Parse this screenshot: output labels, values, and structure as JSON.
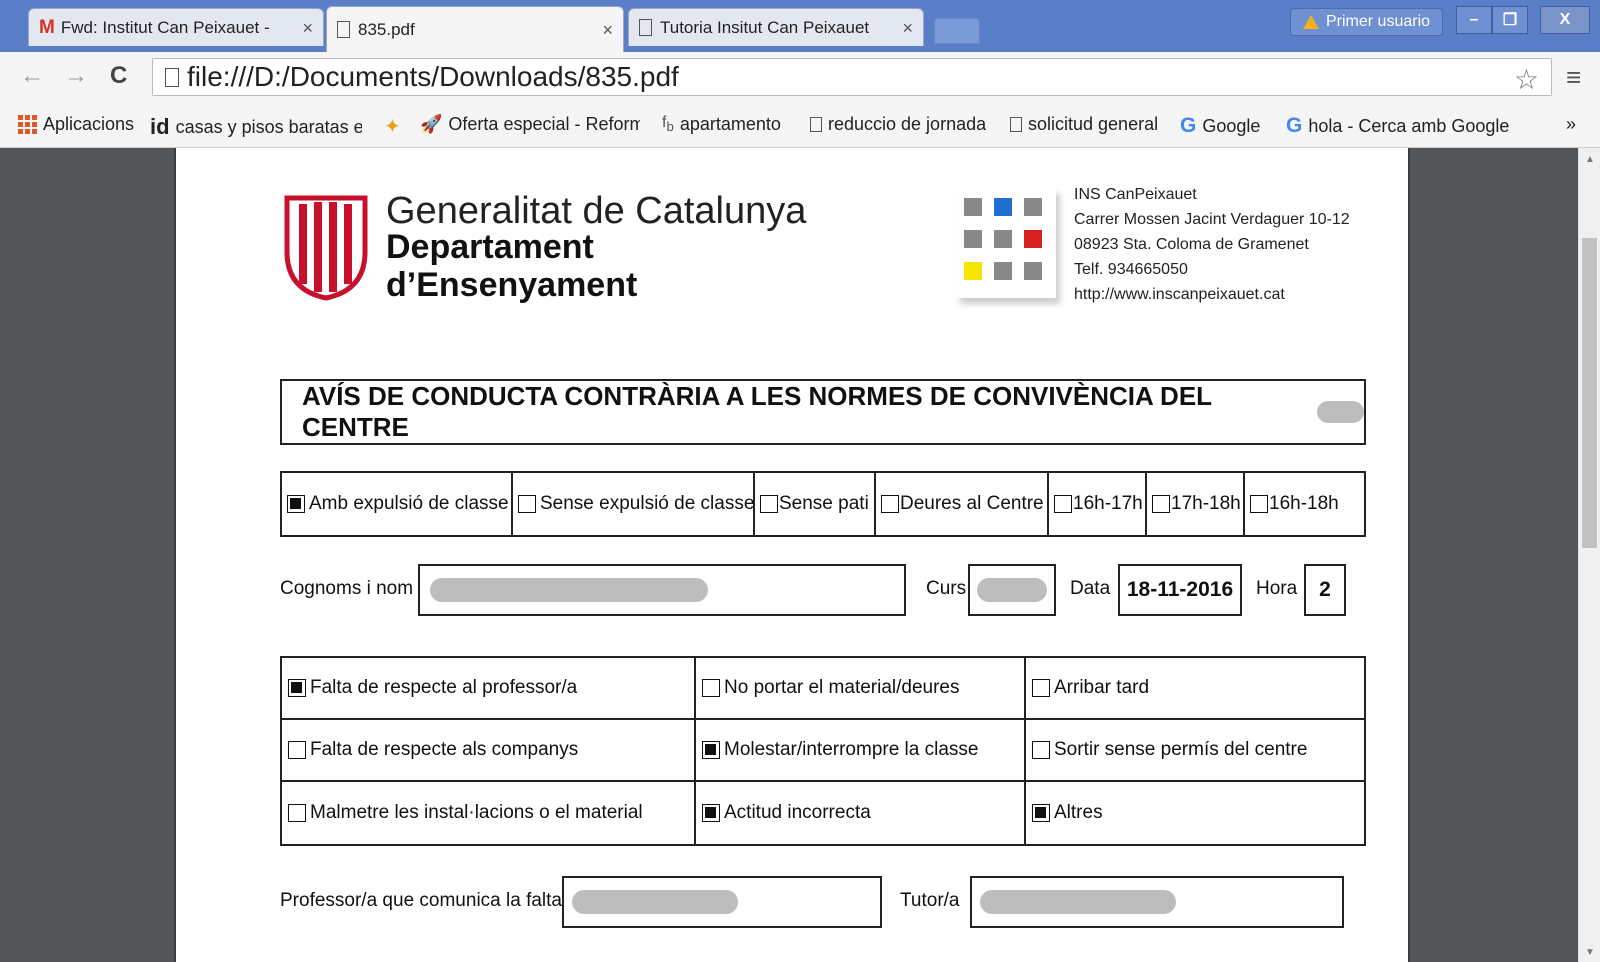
{
  "browser": {
    "tabs": [
      {
        "icon": "gmail-icon",
        "label": "Fwd: Institut Can Peixauet -"
      },
      {
        "icon": "page-icon",
        "label": "835.pdf"
      },
      {
        "icon": "page-icon",
        "label": "Tutoria Insitut Can Peixauet"
      }
    ],
    "tab_close": "×",
    "user_label": "Primer usuario",
    "window_buttons": {
      "minimize": "–",
      "restore": "❐",
      "close": "X"
    },
    "url": "file:///D:/Documents/Downloads/835.pdf",
    "nav": {
      "back": "←",
      "forward": "→",
      "reload": "C"
    },
    "star": "☆",
    "menu": "≡",
    "bookmarks": [
      {
        "icon": "apps-icon",
        "label": "Aplicacions"
      },
      {
        "icon": "id-icon",
        "label": "casas y pisos baratas er"
      },
      {
        "icon": "pinwheel-icon",
        "label": ""
      },
      {
        "icon": "rocket-icon",
        "label": "Oferta especial - Reform"
      },
      {
        "icon": "fb-icon",
        "label": "apartamento"
      },
      {
        "icon": "page-icon",
        "label": "reduccio de jornada"
      },
      {
        "icon": "page-icon",
        "label": "solicitud general"
      },
      {
        "icon": "google-icon",
        "label": "Google"
      },
      {
        "icon": "google-icon",
        "label": "hola - Cerca amb Google"
      }
    ],
    "bookmarks_more": "»"
  },
  "colors": {
    "titlebar": "#5a7fc8",
    "viewer_bg": "#525659",
    "seal_red": "#c8102e",
    "logo_blue": "#1f6fd1",
    "logo_red": "#d72020",
    "logo_yellow": "#f5e600"
  },
  "document": {
    "org_line1": "Generalitat de Catalunya",
    "org_line2": "Departament",
    "org_line3": "d’Ensenyament",
    "school": {
      "name": "INS CanPeixauet",
      "address": "Carrer Mossen Jacint Verdaguer 10-12",
      "city": "08923 Sta. Coloma de Gramenet",
      "phone": "Telf. 934665050",
      "web": "http://www.inscanpeixauet.cat"
    },
    "title": "AVÍS DE CONDUCTA CONTRÀRIA A LES NORMES DE CONVIVÈNCIA DEL CENTRE",
    "options": [
      {
        "label": "Amb expulsió de classe",
        "checked": true
      },
      {
        "label": "Sense expulsió de classe",
        "checked": false
      },
      {
        "label": "Sense pati",
        "checked": false
      },
      {
        "label": "Deures al Centre",
        "checked": false
      },
      {
        "label": "16h-17h",
        "checked": false
      },
      {
        "label": "17h-18h",
        "checked": false
      },
      {
        "label": "16h-18h",
        "checked": false
      }
    ],
    "student_label": "Cognoms i nom",
    "course_label": "Curs",
    "date_label": "Data",
    "date_value": "18-11-2016",
    "hour_label": "Hora",
    "hour_value": "2",
    "conducts": [
      {
        "label": "Falta de respecte al professor/a",
        "checked": true
      },
      {
        "label": "No portar el material/deures",
        "checked": false
      },
      {
        "label": "Arribar tard",
        "checked": false
      },
      {
        "label": "Falta de respecte als companys",
        "checked": false
      },
      {
        "label": "Molestar/interrompre la classe",
        "checked": true
      },
      {
        "label": "Sortir sense permís del centre",
        "checked": false
      },
      {
        "label": "Malmetre les instal·lacions o el material",
        "checked": false
      },
      {
        "label": "Actitud incorrecta",
        "checked": true
      },
      {
        "label": "Altres",
        "checked": true
      }
    ],
    "teacher_label": "Professor/a que comunica la falta",
    "tutor_label": "Tutor/a"
  }
}
